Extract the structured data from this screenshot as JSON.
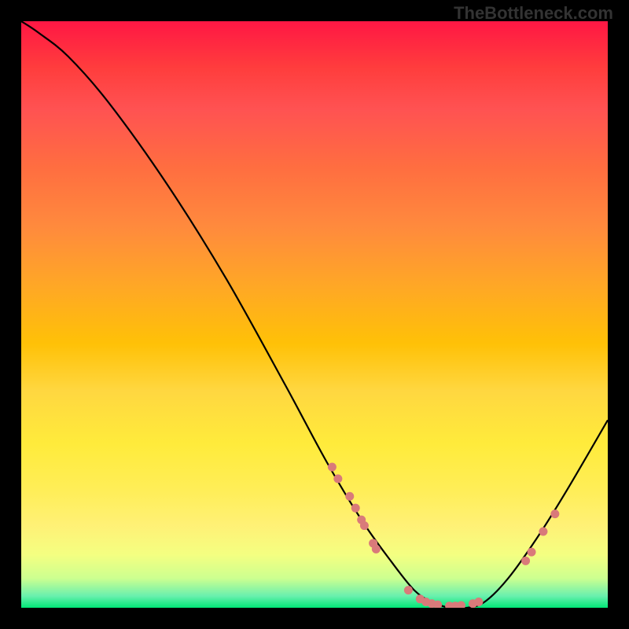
{
  "watermark": "TheBottleneck.com",
  "chart_data": {
    "type": "line",
    "title": "",
    "xlabel": "",
    "ylabel": "",
    "xlim": [
      0,
      100
    ],
    "ylim": [
      0,
      100
    ],
    "curve": [
      {
        "x": 0,
        "y": 100
      },
      {
        "x": 3,
        "y": 98
      },
      {
        "x": 8,
        "y": 94
      },
      {
        "x": 15,
        "y": 86
      },
      {
        "x": 25,
        "y": 72
      },
      {
        "x": 35,
        "y": 56
      },
      {
        "x": 45,
        "y": 38
      },
      {
        "x": 52,
        "y": 25
      },
      {
        "x": 58,
        "y": 15
      },
      {
        "x": 63,
        "y": 8
      },
      {
        "x": 67,
        "y": 3
      },
      {
        "x": 70,
        "y": 1
      },
      {
        "x": 73,
        "y": 0
      },
      {
        "x": 76,
        "y": 0
      },
      {
        "x": 79,
        "y": 1
      },
      {
        "x": 83,
        "y": 5
      },
      {
        "x": 88,
        "y": 12
      },
      {
        "x": 93,
        "y": 20
      },
      {
        "x": 100,
        "y": 32
      }
    ],
    "markers": [
      {
        "x": 53,
        "y": 24
      },
      {
        "x": 54,
        "y": 22
      },
      {
        "x": 56,
        "y": 19
      },
      {
        "x": 57,
        "y": 17
      },
      {
        "x": 58,
        "y": 15
      },
      {
        "x": 58.5,
        "y": 14
      },
      {
        "x": 60,
        "y": 11
      },
      {
        "x": 60.5,
        "y": 10
      },
      {
        "x": 66,
        "y": 3
      },
      {
        "x": 68,
        "y": 1.5
      },
      {
        "x": 69,
        "y": 1
      },
      {
        "x": 70,
        "y": 0.7
      },
      {
        "x": 71,
        "y": 0.5
      },
      {
        "x": 73,
        "y": 0.3
      },
      {
        "x": 74,
        "y": 0.3
      },
      {
        "x": 75,
        "y": 0.4
      },
      {
        "x": 77,
        "y": 0.7
      },
      {
        "x": 78,
        "y": 1
      },
      {
        "x": 86,
        "y": 8
      },
      {
        "x": 87,
        "y": 9.5
      },
      {
        "x": 89,
        "y": 13
      },
      {
        "x": 91,
        "y": 16
      }
    ],
    "marker_color": "#d97a7a",
    "curve_color": "#000000"
  }
}
